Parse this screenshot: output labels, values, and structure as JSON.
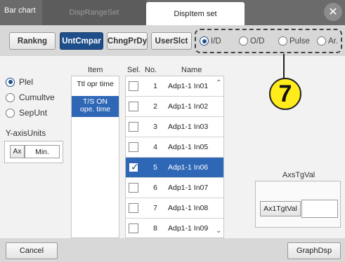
{
  "tabs": {
    "bar_chart": "Bar chart",
    "disp_range": "DispRangeSet",
    "disp_item": "DispItem set"
  },
  "close": "✕",
  "toolbar": {
    "buttons": [
      "Rankng",
      "UntCmpar",
      "ChngPrDy",
      "UserSlct"
    ],
    "active": "UntCmpar",
    "radios": [
      "I/D",
      "O/D",
      "Pulse",
      "Ar."
    ],
    "selected_radio": "I/D"
  },
  "callout": "7",
  "left_panel": {
    "options": [
      "Plel",
      "Cumultve",
      "SepUnt"
    ],
    "selected": "Plel",
    "yaxis_title": "Y-axisUnits",
    "ax_label": "Ax",
    "min_label": "Min."
  },
  "item_list": {
    "header": "Item",
    "rows": [
      "Ttl opr time",
      "T/S ON",
      "ope. time"
    ],
    "selected": "T/S ON ope. time"
  },
  "select_list": {
    "headers": [
      "Sel.",
      "No.",
      "Name"
    ],
    "rows": [
      {
        "no": "1",
        "name": "Adp1-1 In01",
        "checked": false
      },
      {
        "no": "2",
        "name": "Adp1-1 In02",
        "checked": false
      },
      {
        "no": "3",
        "name": "Adp1-1 In03",
        "checked": false
      },
      {
        "no": "4",
        "name": "Adp1-1 In05",
        "checked": false
      },
      {
        "no": "5",
        "name": "Adp1-1 In06",
        "checked": true
      },
      {
        "no": "6",
        "name": "Adp1-1 In07",
        "checked": false
      },
      {
        "no": "7",
        "name": "Adp1-1 In08",
        "checked": false
      },
      {
        "no": "8",
        "name": "Adp1-1 In09",
        "checked": false
      }
    ],
    "selected_no": "5"
  },
  "axs": {
    "title": "AxsTgVal",
    "button": "Ax1TgtVal",
    "value": ""
  },
  "footer": {
    "cancel": "Cancel",
    "graph": "GraphDsp"
  }
}
